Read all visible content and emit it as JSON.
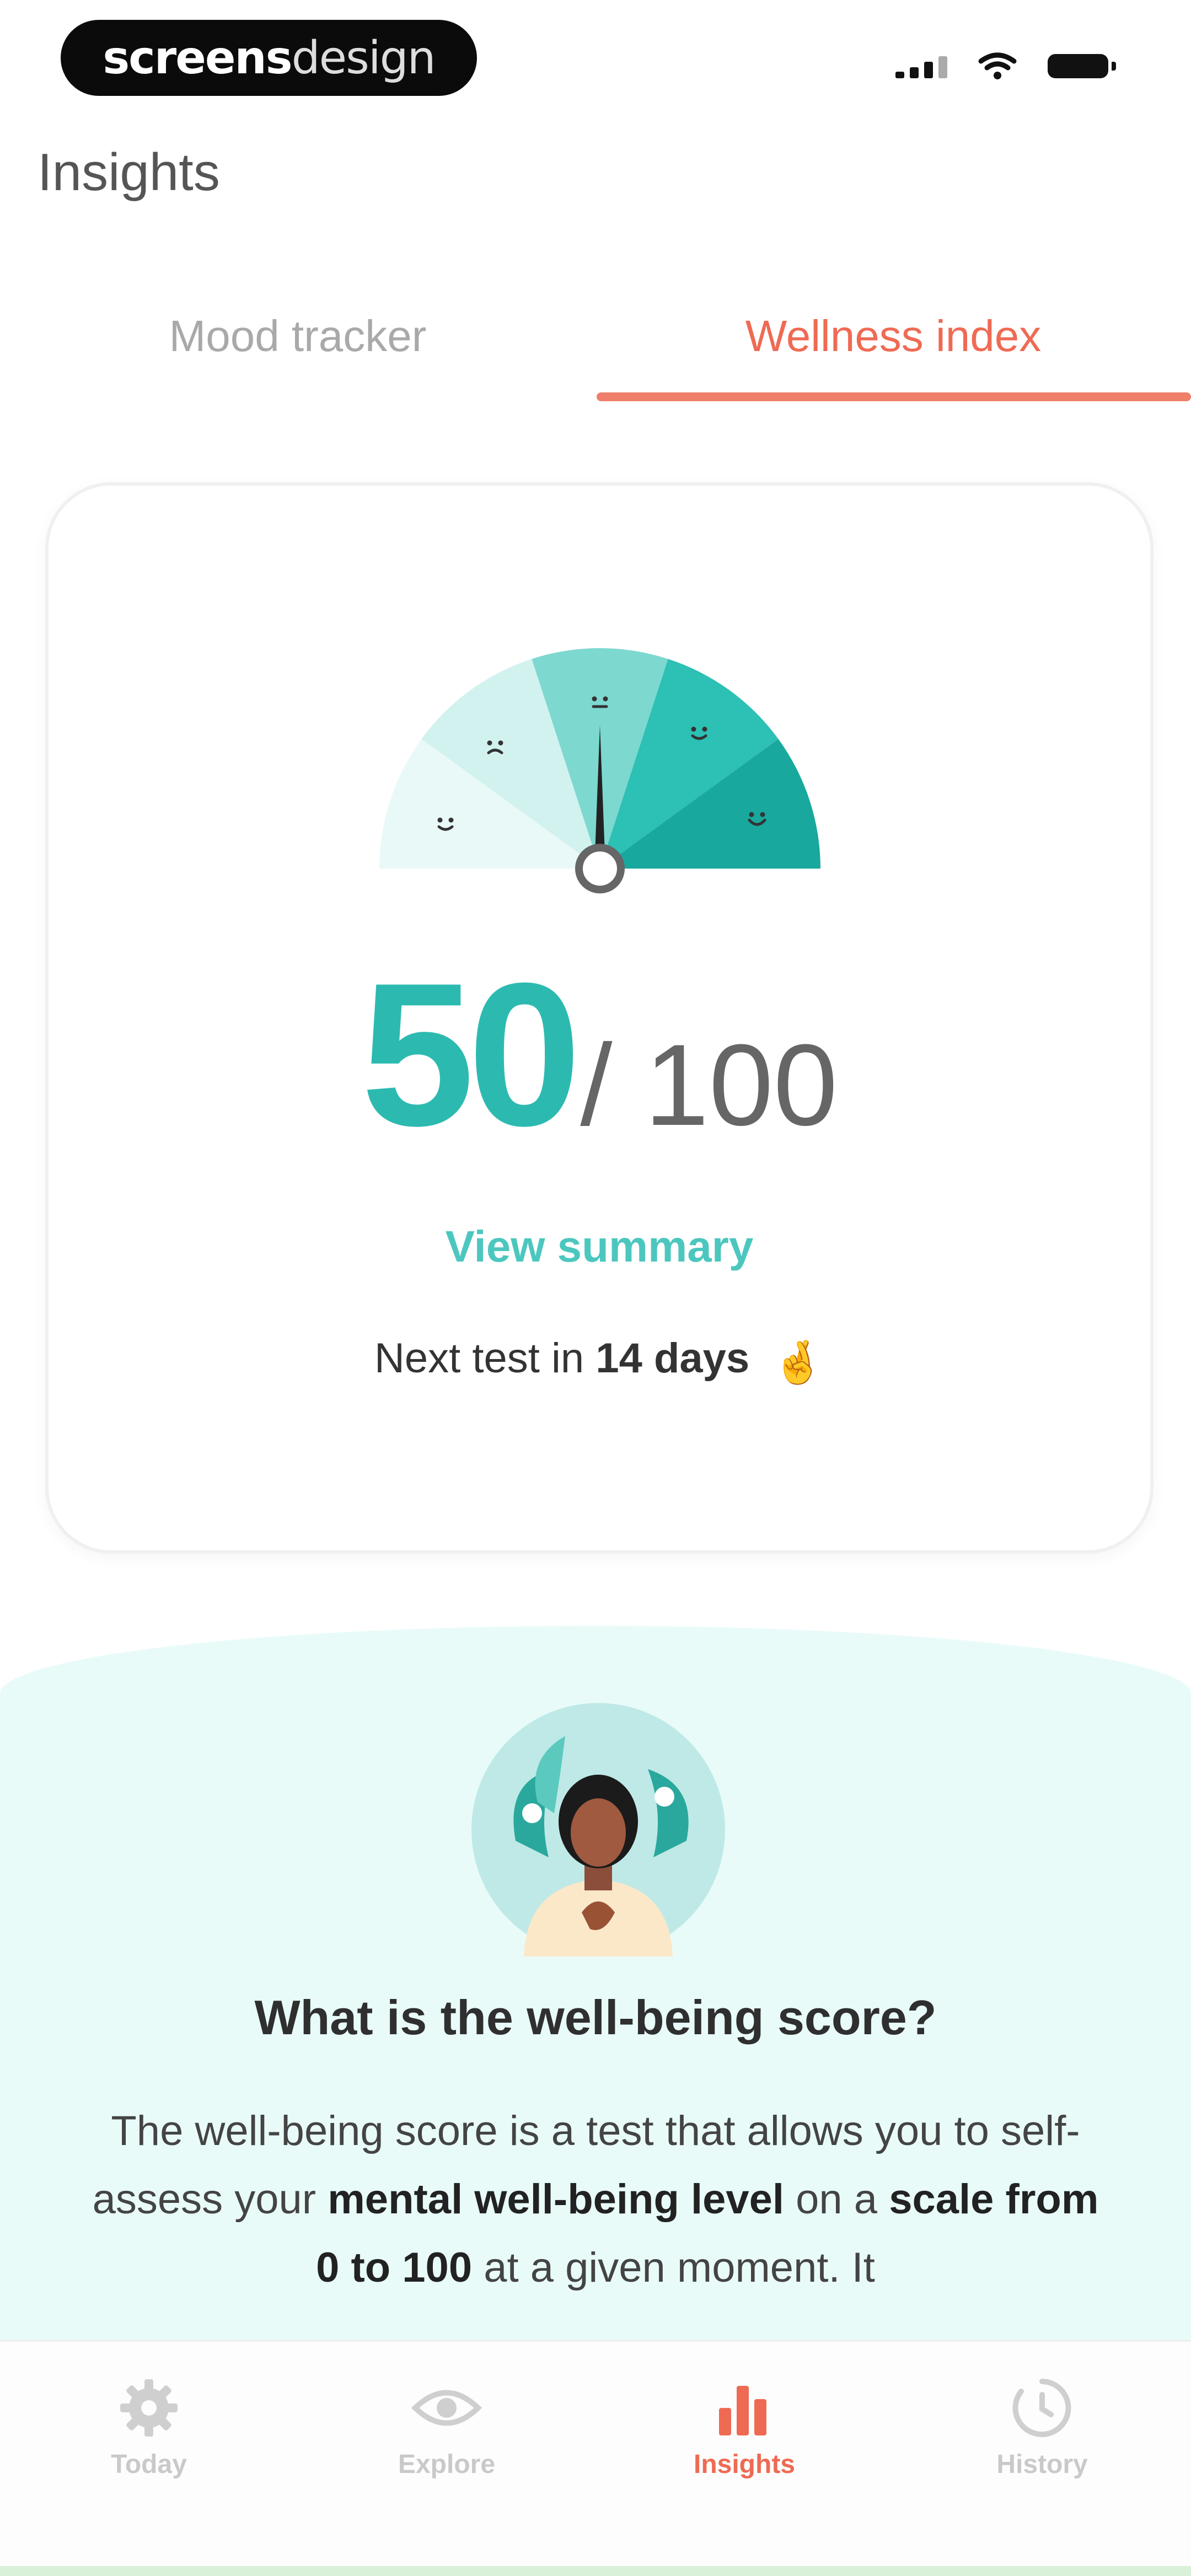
{
  "status_bar": {
    "brand_bold": "screens",
    "brand_light": "design"
  },
  "header": {
    "title": "Insights"
  },
  "tabs": [
    {
      "label": "Mood tracker",
      "active": false
    },
    {
      "label": "Wellness index",
      "active": true
    }
  ],
  "score_card": {
    "score": "50",
    "max": "/ 100",
    "score_fraction": 0.5,
    "view_summary_label": "View summary",
    "next_test_prefix": "Next test in",
    "next_test_value": "14 days",
    "emoji": "🤞"
  },
  "info": {
    "heading": "What is the well-being score?",
    "body_1": "The well-being score is a test that allows you to self-assess your",
    "body_bold_1": "mental well-being level",
    "body_2": "on a",
    "body_bold_2": "scale from 0 to 100",
    "body_3": "at a given moment. It"
  },
  "bottom_nav": [
    {
      "label": "Today",
      "icon": "gear-icon",
      "active": false
    },
    {
      "label": "Explore",
      "icon": "eye-icon",
      "active": false
    },
    {
      "label": "Insights",
      "icon": "bar-chart-icon",
      "active": true
    },
    {
      "label": "History",
      "icon": "clock-icon",
      "active": false
    }
  ],
  "colors": {
    "accent": "#ef6a53",
    "teal": "#2cbab0",
    "panel_bg": "#e8fbf9"
  }
}
